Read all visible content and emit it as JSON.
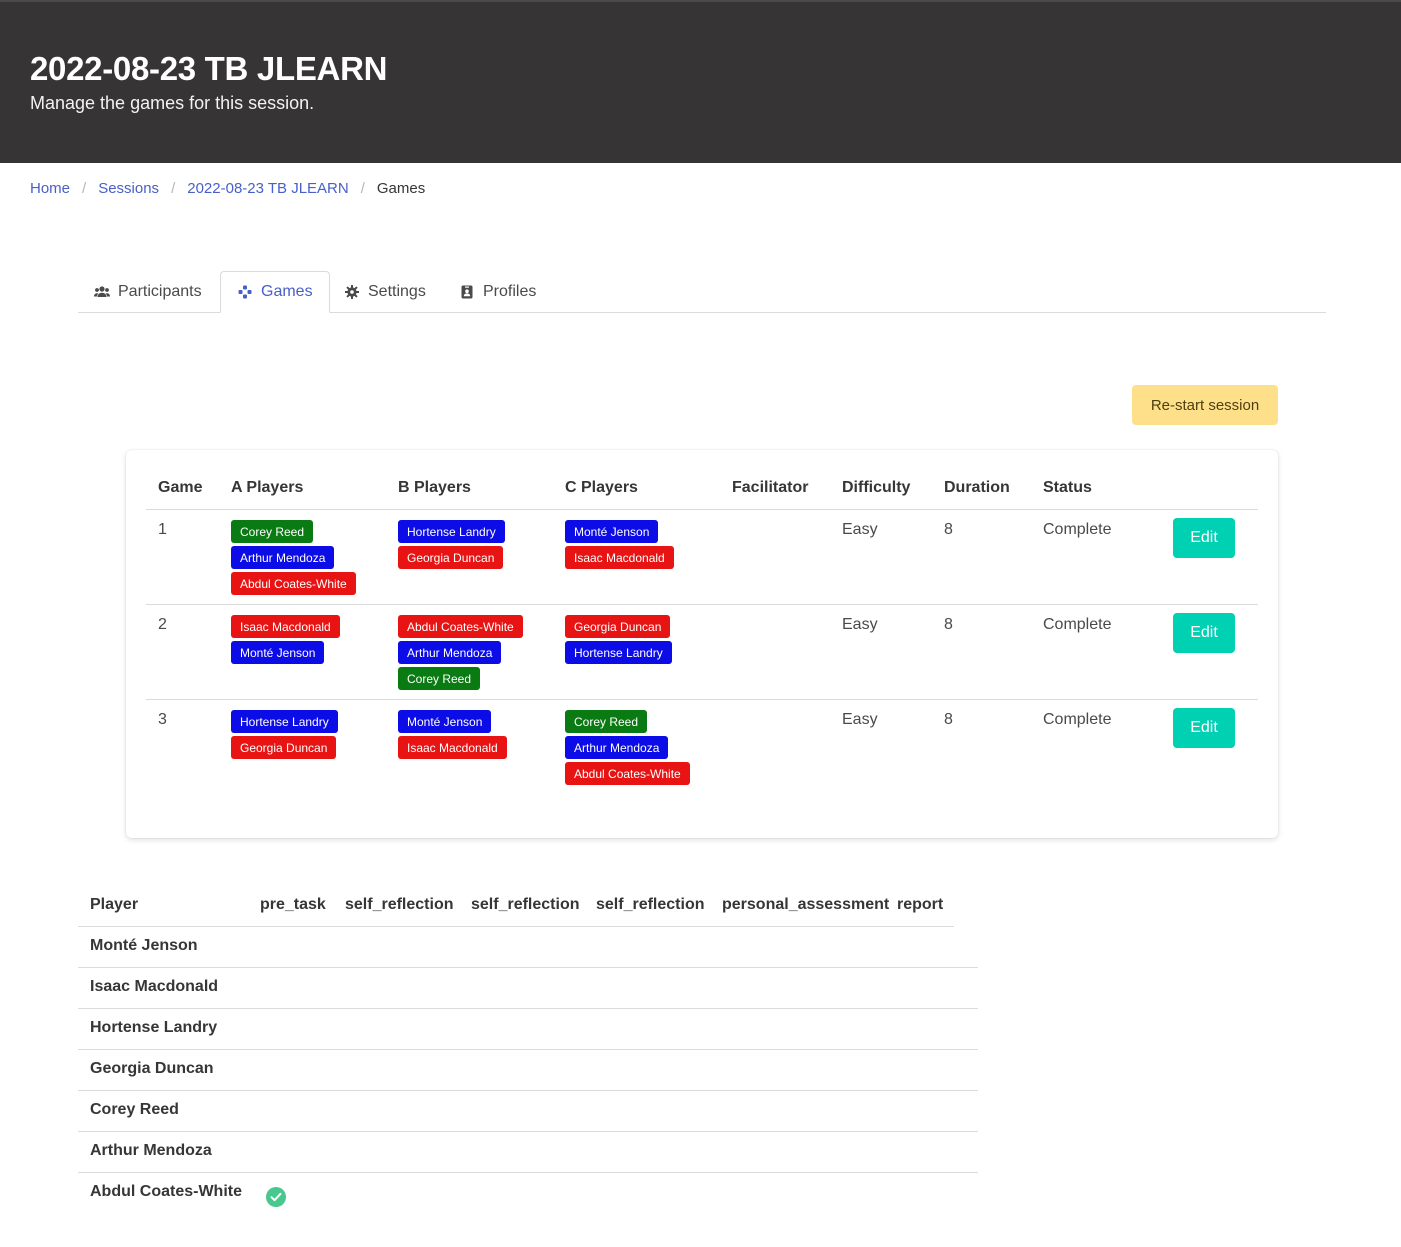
{
  "hero": {
    "title": "2022-08-23 TB JLEARN",
    "subtitle": "Manage the games for this session."
  },
  "breadcrumb": [
    "Home",
    "Sessions",
    "2022-08-23 TB JLEARN",
    "Games"
  ],
  "tabs": [
    {
      "label": "Participants",
      "icon": "users-icon"
    },
    {
      "label": "Games",
      "icon": "gamepad-icon",
      "active": true
    },
    {
      "label": "Settings",
      "icon": "gear-icon"
    },
    {
      "label": "Profiles",
      "icon": "id-badge-icon"
    }
  ],
  "actions": {
    "restart_label": "Re-start session"
  },
  "games_table": {
    "headers": [
      "Game",
      "A Players",
      "B Players",
      "C Players",
      "Facilitator",
      "Difficulty",
      "Duration",
      "Status"
    ],
    "edit_label": "Edit",
    "rows": [
      {
        "game": "1",
        "a_players": [
          {
            "name": "Corey Reed",
            "color": "green"
          },
          {
            "name": "Arthur Mendoza",
            "color": "blue"
          },
          {
            "name": "Abdul Coates-White",
            "color": "red"
          }
        ],
        "b_players": [
          {
            "name": "Hortense Landry",
            "color": "blue"
          },
          {
            "name": "Georgia Duncan",
            "color": "red"
          }
        ],
        "c_players": [
          {
            "name": "Monté Jenson",
            "color": "blue"
          },
          {
            "name": "Isaac Macdonald",
            "color": "red"
          }
        ],
        "facilitator": "",
        "difficulty": "Easy",
        "duration": "8",
        "status": "Complete"
      },
      {
        "game": "2",
        "a_players": [
          {
            "name": "Isaac Macdonald",
            "color": "red"
          },
          {
            "name": "Monté Jenson",
            "color": "blue"
          }
        ],
        "b_players": [
          {
            "name": "Abdul Coates-White",
            "color": "red"
          },
          {
            "name": "Arthur Mendoza",
            "color": "blue"
          },
          {
            "name": "Corey Reed",
            "color": "green"
          }
        ],
        "c_players": [
          {
            "name": "Georgia Duncan",
            "color": "red"
          },
          {
            "name": "Hortense Landry",
            "color": "blue"
          }
        ],
        "facilitator": "",
        "difficulty": "Easy",
        "duration": "8",
        "status": "Complete"
      },
      {
        "game": "3",
        "a_players": [
          {
            "name": "Hortense Landry",
            "color": "blue"
          },
          {
            "name": "Georgia Duncan",
            "color": "red"
          }
        ],
        "b_players": [
          {
            "name": "Monté Jenson",
            "color": "blue"
          },
          {
            "name": "Isaac Macdonald",
            "color": "red"
          }
        ],
        "c_players": [
          {
            "name": "Corey Reed",
            "color": "green"
          },
          {
            "name": "Arthur Mendoza",
            "color": "blue"
          },
          {
            "name": "Abdul Coates-White",
            "color": "red"
          }
        ],
        "facilitator": "",
        "difficulty": "Easy",
        "duration": "8",
        "status": "Complete"
      }
    ]
  },
  "players_table": {
    "headers": [
      "Player",
      "pre_task",
      "self_reflection",
      "self_reflection",
      "self_reflection",
      "personal_assessment",
      "report"
    ],
    "rows": [
      {
        "name": "Monté Jenson",
        "pre_task_done": false
      },
      {
        "name": "Isaac Macdonald",
        "pre_task_done": false
      },
      {
        "name": "Hortense Landry",
        "pre_task_done": false
      },
      {
        "name": "Georgia Duncan",
        "pre_task_done": false
      },
      {
        "name": "Corey Reed",
        "pre_task_done": false
      },
      {
        "name": "Arthur Mendoza",
        "pre_task_done": false
      },
      {
        "name": "Abdul Coates-White",
        "pre_task_done": true
      }
    ]
  },
  "colors": {
    "hero_bg": "#363434",
    "link": "#485fc7",
    "tag_green": "#0a7a12",
    "tag_blue": "#0b0ce6",
    "tag_red": "#e81414",
    "edit_button": "#00d1b2",
    "restart_button": "#ffe08a",
    "check": "#48c78e"
  }
}
